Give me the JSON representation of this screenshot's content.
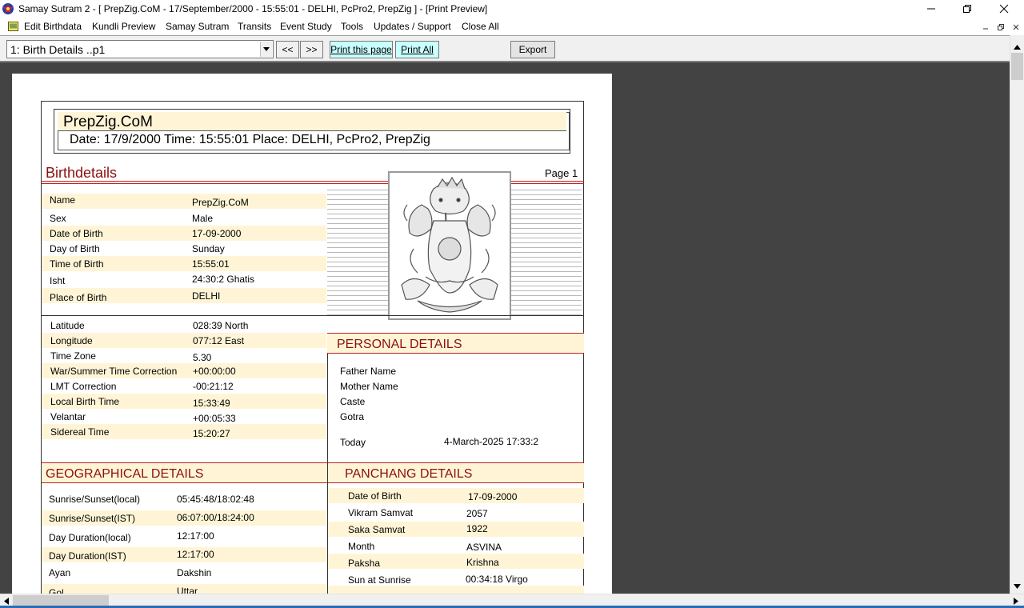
{
  "window": {
    "title": "Samay Sutram 2  -  [ PrepZig.CoM  -  17/September/2000  -  15:55:01  -  DELHI, PcPro2, PrepZig ] - [Print Preview]",
    "minimize": "—",
    "maximize": "❐",
    "close": "✕"
  },
  "menu": {
    "items": [
      "Edit Birthdata",
      "Kundli Preview",
      "Samay Sutram",
      "Transits",
      "Event Study",
      "Tools",
      "Updates / Support",
      "Close All"
    ]
  },
  "toolbar": {
    "page_select_value": "1: Birth Details  ..p1",
    "prev_label": "<<",
    "next_label": ">>",
    "print_page_label": "Print this page",
    "print_all_label": "Print All",
    "export_label": "Export"
  },
  "report": {
    "header_title": "PrepZig.CoM",
    "header_sub": "Date: 17/9/2000  Time: 15:55:01  Place: DELHI, PcPro2, PrepZig",
    "birthdetails_title": "Birthdetails",
    "page_label": "Page 1",
    "birth": [
      {
        "label": "Name",
        "value": "PrepZig.CoM"
      },
      {
        "label": "Sex",
        "value": "Male"
      },
      {
        "label": "Date of Birth",
        "value": "17-09-2000"
      },
      {
        "label": "Day of Birth",
        "value": "Sunday"
      },
      {
        "label": "Time of Birth",
        "value": "15:55:01"
      },
      {
        "label": "Isht",
        "value": "24:30:2 Ghatis"
      },
      {
        "label": "Place of Birth",
        "value": "DELHI"
      }
    ],
    "location": [
      {
        "label": "Latitude",
        "value": "028:39 North"
      },
      {
        "label": "Longitude",
        "value": "077:12 East"
      },
      {
        "label": "Time Zone",
        "value": "5.30"
      },
      {
        "label": "War/Summer Time Correction",
        "value": "+00:00:00"
      },
      {
        "label": "LMT Correction",
        "value": "-00:21:12"
      },
      {
        "label": "Local Birth Time",
        "value": "15:33:49"
      },
      {
        "label": "Velantar",
        "value": "+00:05:33"
      },
      {
        "label": "Sidereal Time",
        "value": "15:20:27"
      }
    ],
    "personal_title": "PERSONAL DETAILS",
    "personal": [
      {
        "label": "Father Name",
        "value": ""
      },
      {
        "label": "Mother Name",
        "value": ""
      },
      {
        "label": "Caste",
        "value": ""
      },
      {
        "label": "Gotra",
        "value": ""
      }
    ],
    "today_label": "Today",
    "today_value": "4-March-2025  17:33:2",
    "geo_title": "GEOGRAPHICAL DETAILS",
    "geo": [
      {
        "label": "Sunrise/Sunset(local)",
        "value": "05:45:48/18:02:48"
      },
      {
        "label": "Sunrise/Sunset(IST)",
        "value": "06:07:00/18:24:00"
      },
      {
        "label": "Day Duration(local)",
        "value": "12:17:00"
      },
      {
        "label": "Day Duration(IST)",
        "value": "12:17:00"
      },
      {
        "label": "Ayan",
        "value": "Dakshin"
      },
      {
        "label": "Gol",
        "value": "Uttar"
      }
    ],
    "panchang_title": "PANCHANG DETAILS",
    "panchang": [
      {
        "label": "Date of Birth",
        "value": "17-09-2000"
      },
      {
        "label": "Vikram Samvat",
        "value": "2057"
      },
      {
        "label": "Saka Samvat",
        "value": "1922"
      },
      {
        "label": "Month",
        "value": "ASVINA"
      },
      {
        "label": "Paksha",
        "value": "Krishna"
      },
      {
        "label": "Sun at Sunrise",
        "value": "00:34:18 Virgo"
      }
    ],
    "image_name": "ganesha-illustration"
  }
}
